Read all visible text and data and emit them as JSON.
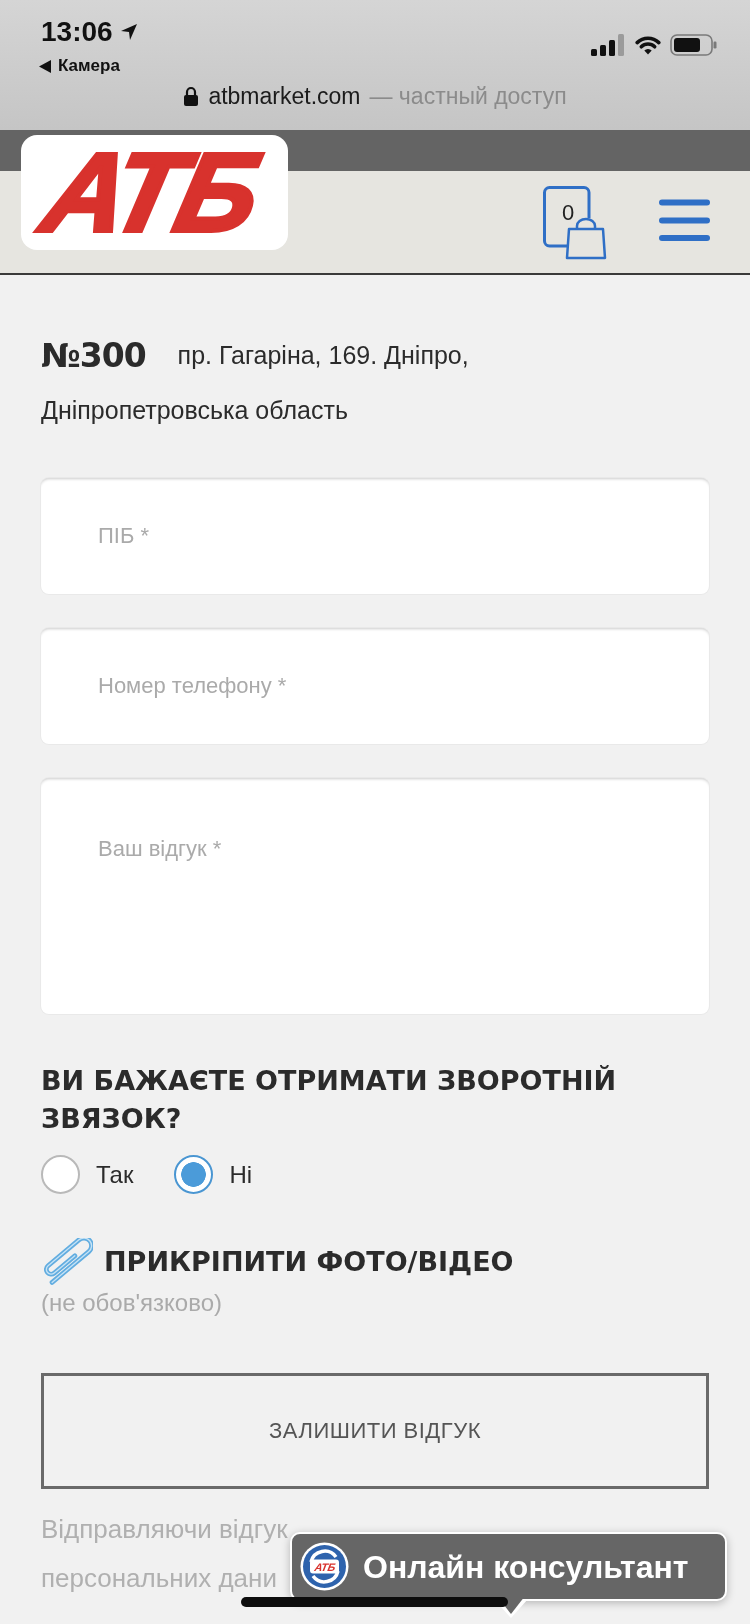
{
  "status_bar": {
    "time": "13:06",
    "back_label": "Камера"
  },
  "address_bar": {
    "domain": "atbmarket.com",
    "note": "— частный доступ"
  },
  "header": {
    "logo": "АТБ",
    "cart_count": "0"
  },
  "store": {
    "number": "№300",
    "address_lines": [
      "пр. Гагаріна, 169. Дніпро,",
      "Дніпропетровська область"
    ]
  },
  "form": {
    "fields": [
      {
        "kind": "text",
        "placeholder": "ПІБ *"
      },
      {
        "kind": "text",
        "placeholder": "Номер телефону *"
      },
      {
        "kind": "textarea",
        "placeholder": "Ваш відгук *"
      }
    ],
    "callback_question": "ВИ БАЖАЄТЕ ОТРИМАТИ ЗВОРОТНІЙ ЗВЯЗОК?",
    "callback_options": [
      {
        "label": "Так",
        "selected": false
      },
      {
        "label": "Ні",
        "selected": true
      }
    ],
    "attach": {
      "label": "ПРИКРІПИТИ ФОТО/ВІДЕО",
      "note": "(не обов'язково)"
    },
    "submit": "ЗАЛИШИТИ ВІДГУК",
    "disclaimer_lines": [
      "Відправляючи відгук",
      "персональних дани"
    ]
  },
  "chat_widget": {
    "logo": "АТБ",
    "label": "Онлайн консультант"
  }
}
